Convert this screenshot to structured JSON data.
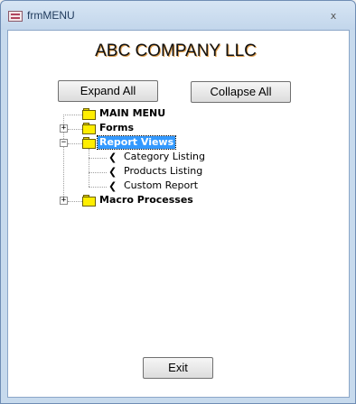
{
  "window": {
    "title": "frmMENU",
    "close_glyph": "x",
    "icon": "form-icon"
  },
  "app_title": "ABC COMPANY LLC",
  "buttons": {
    "expand_all": "Expand All",
    "collapse_all": "Collapse All",
    "exit": "Exit"
  },
  "tree": {
    "nodes": [
      {
        "label": "MAIN MENU",
        "type": "folder",
        "expander": ""
      },
      {
        "label": "Forms",
        "type": "folder",
        "expander": "+"
      },
      {
        "label": "Report Views",
        "type": "folder",
        "expander": "−",
        "selected": true,
        "children": [
          "Category Listing",
          "Products Listing",
          "Custom Report"
        ]
      },
      {
        "label": "Macro Processes",
        "type": "folder",
        "expander": "+"
      }
    ],
    "leaf_glyph": "❮"
  },
  "colors": {
    "selection": "#3399ff",
    "folder": "#ffee00",
    "frame": "#c7daed"
  }
}
